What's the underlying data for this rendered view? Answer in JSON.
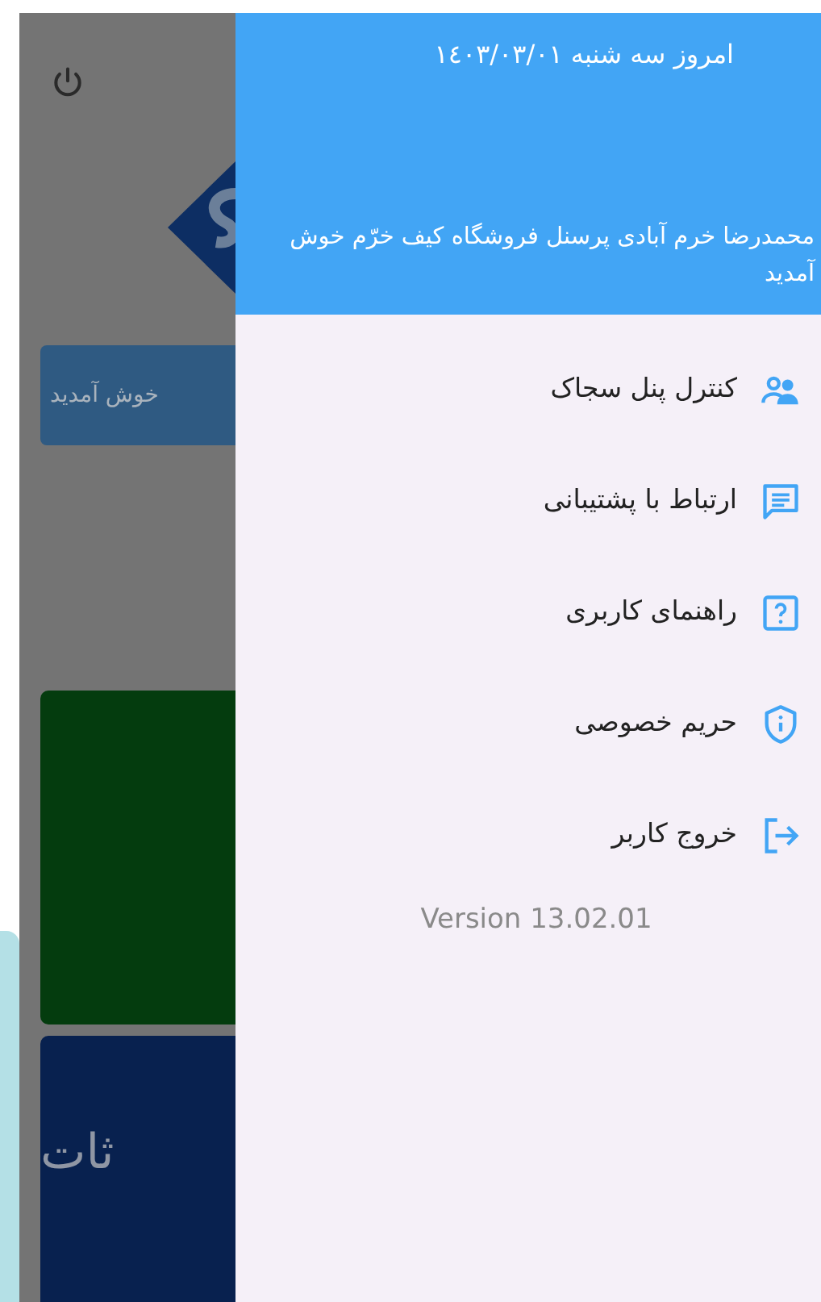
{
  "background_screen": {
    "welcome_button": "خوش آمدید",
    "tile_text": "ثات"
  },
  "drawer": {
    "date": "امروز سه شنبه ١٤٠٣/٠٣/٠١",
    "greeting": "محمدرضا خرم آبادی پرسنل فروشگاه کیف خرّم خوش آمدید",
    "items": [
      {
        "kind": "panel",
        "label": "کنترل پنل سجاک"
      },
      {
        "kind": "support",
        "label": "ارتباط با پشتیبانی"
      },
      {
        "kind": "help",
        "label": "راهنمای کاربری"
      },
      {
        "kind": "privacy",
        "label": "حریم خصوصی"
      },
      {
        "kind": "logout",
        "label": "خروج کاربر"
      }
    ],
    "version": "Version 13.02.01"
  }
}
